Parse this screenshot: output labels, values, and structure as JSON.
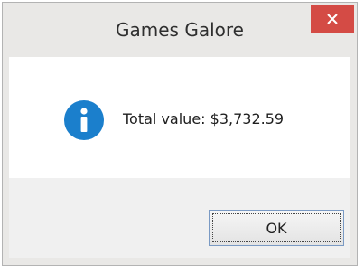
{
  "dialog": {
    "title": "Games Galore",
    "message": "Total value: $3,732.59",
    "ok_label": "OK",
    "icon": "info-icon",
    "colors": {
      "close_button": "#d44b45",
      "info_icon": "#1b7fcc",
      "frame": "#e9e8e6",
      "content_bg": "#ffffff"
    }
  }
}
